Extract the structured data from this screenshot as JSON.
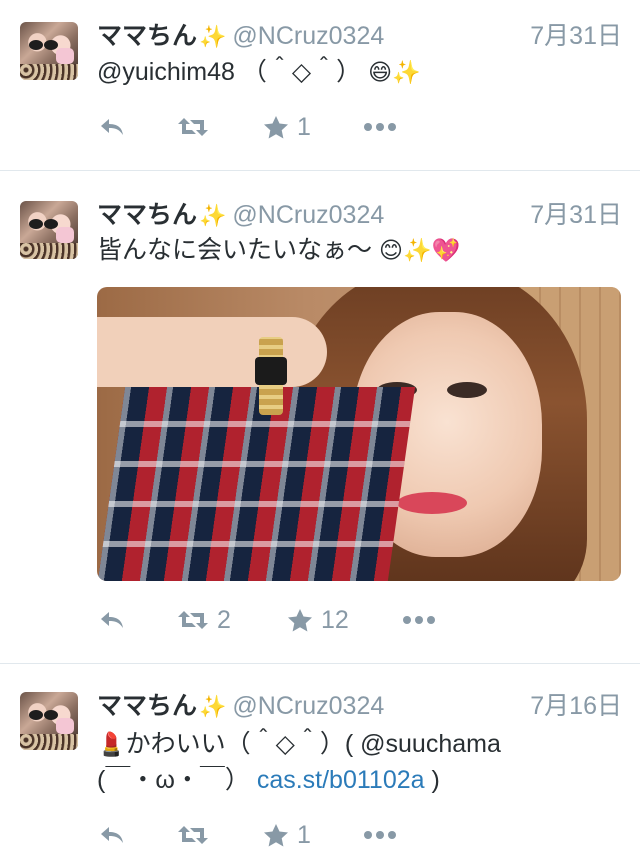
{
  "tweets": [
    {
      "name": "ママちん",
      "sparkle": "✨",
      "handle": "@NCruz0324",
      "date": "7月31日",
      "lines": [
        "@yuichim48 （＾◇＾）"
      ],
      "line_emoji": "😄✨",
      "stats": {
        "reply": "",
        "retweet": "",
        "favorite": "1"
      }
    },
    {
      "name": "ママちん",
      "sparkle": "✨",
      "handle": "@NCruz0324",
      "date": "7月31日",
      "lines": [
        "皆んなに会いたいなぁ〜"
      ],
      "line_emoji": "😊✨💖",
      "stats": {
        "reply": "",
        "retweet": "2",
        "favorite": "12"
      }
    },
    {
      "name": "ママちん",
      "sparkle": "✨",
      "handle": "@NCruz0324",
      "date": "7月16日",
      "lines_prefix_emoji": "💄",
      "lines": [
        "かわいい（＾◇＾）( @suuchama",
        "(￣・ω・￣）"
      ],
      "link": "cas.st/b01102a",
      "line_suffix": " )",
      "stats": {
        "reply": "",
        "retweet": "",
        "favorite": "1"
      }
    }
  ],
  "icons": [
    "reply-icon",
    "retweet-icon",
    "favorite-star-icon",
    "more-dots-icon",
    "avatar",
    "sparkle-icon"
  ],
  "colors": {
    "text": "#292f33",
    "muted": "#8899a6",
    "link": "#2b7bb9",
    "divider": "#e1e8ed"
  }
}
